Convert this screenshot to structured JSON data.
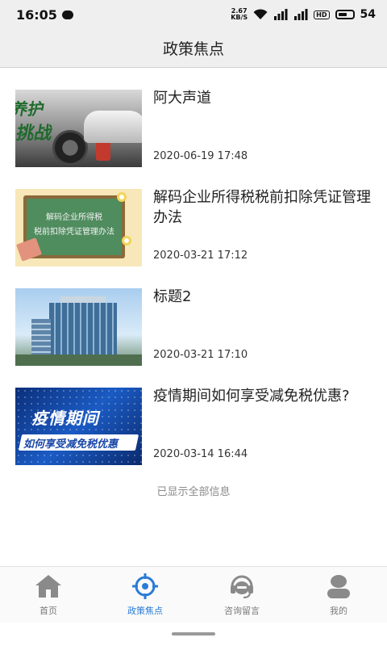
{
  "status_bar": {
    "time": "16:05",
    "net_speed_value": "2.67",
    "net_speed_unit": "KB/S",
    "hd_label": "HD",
    "battery": "54"
  },
  "header": {
    "title": "政策焦点"
  },
  "news": [
    {
      "title": "阿大声道",
      "date": "2020-06-19 17:48",
      "thumb_text": [
        "养护",
        "挑战"
      ]
    },
    {
      "title": "解码企业所得税税前扣除凭证管理办法",
      "date": "2020-03-21 17:12",
      "thumb_text": [
        "解码企业所得税",
        "税前扣除凭证管理办法"
      ]
    },
    {
      "title": "标题2",
      "date": "2020-03-21 17:10",
      "thumb_text": []
    },
    {
      "title": "疫情期间如何享受减免税优惠?",
      "date": "2020-03-14 16:44",
      "thumb_text": [
        "疫情期间",
        "如何享受减免税优惠"
      ]
    }
  ],
  "end_note": "已显示全部信息",
  "tabs": [
    {
      "label": "首页",
      "icon": "home-icon",
      "active": false
    },
    {
      "label": "政策焦点",
      "icon": "target-icon",
      "active": true
    },
    {
      "label": "咨询留言",
      "icon": "headset-icon",
      "active": false
    },
    {
      "label": "我的",
      "icon": "user-icon",
      "active": false
    }
  ],
  "colors": {
    "accent": "#2a7bd6",
    "inactive_icon": "#8a8a8a",
    "header_bg": "#efefef"
  }
}
